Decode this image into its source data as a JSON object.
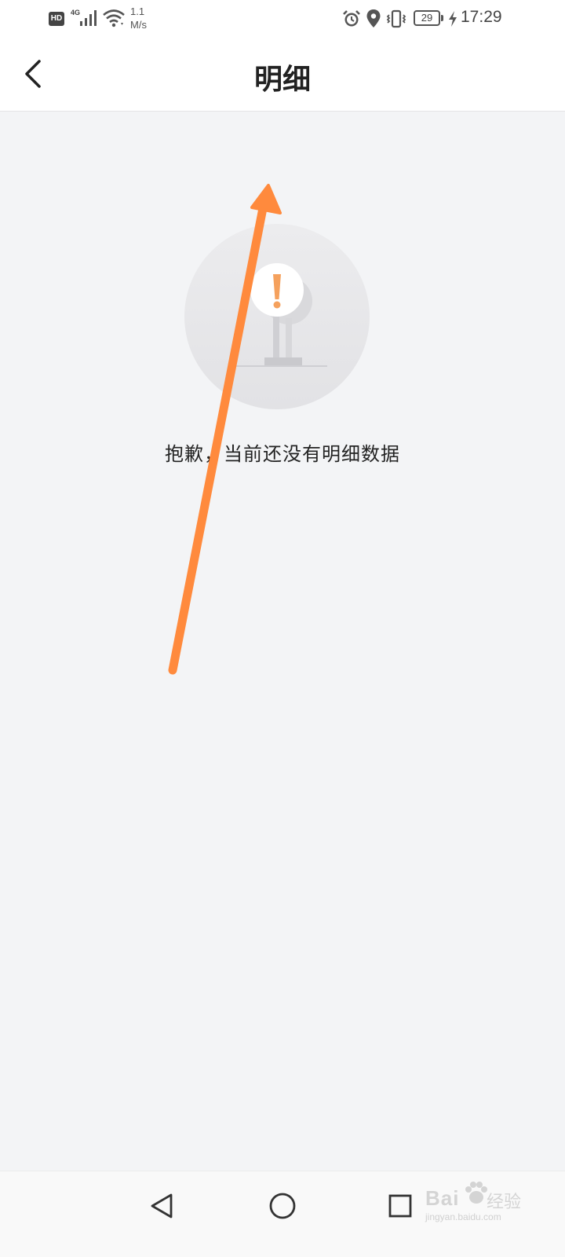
{
  "status_bar": {
    "hd_label": "HD",
    "network_type": "4G",
    "net_speed_value": "1.1",
    "net_speed_unit": "M/s",
    "battery_level": "29",
    "time": "17:29",
    "icons": [
      "hd-badge",
      "signal-icon",
      "wifi-icon",
      "alarm-icon",
      "location-icon",
      "vibrate-icon",
      "battery-icon",
      "charging-icon"
    ]
  },
  "header": {
    "title": "明细",
    "back_icon": "chevron-left-icon"
  },
  "empty_state": {
    "message": "抱歉，当前还没有明细数据",
    "illustration_icon": "exclamation-sign-icon"
  },
  "annotation": {
    "type": "arrow",
    "color": "#ff8a3d"
  },
  "nav_bar": {
    "icons": [
      "nav-back-icon",
      "nav-home-icon",
      "nav-recents-icon"
    ]
  },
  "watermark": {
    "brand": "Bai",
    "brand_suffix": "经验",
    "url": "jingyan.baidu.com"
  },
  "colors": {
    "background": "#f3f4f6",
    "header_bg": "#ffffff",
    "accent": "#f5a15d",
    "text": "#222222"
  }
}
